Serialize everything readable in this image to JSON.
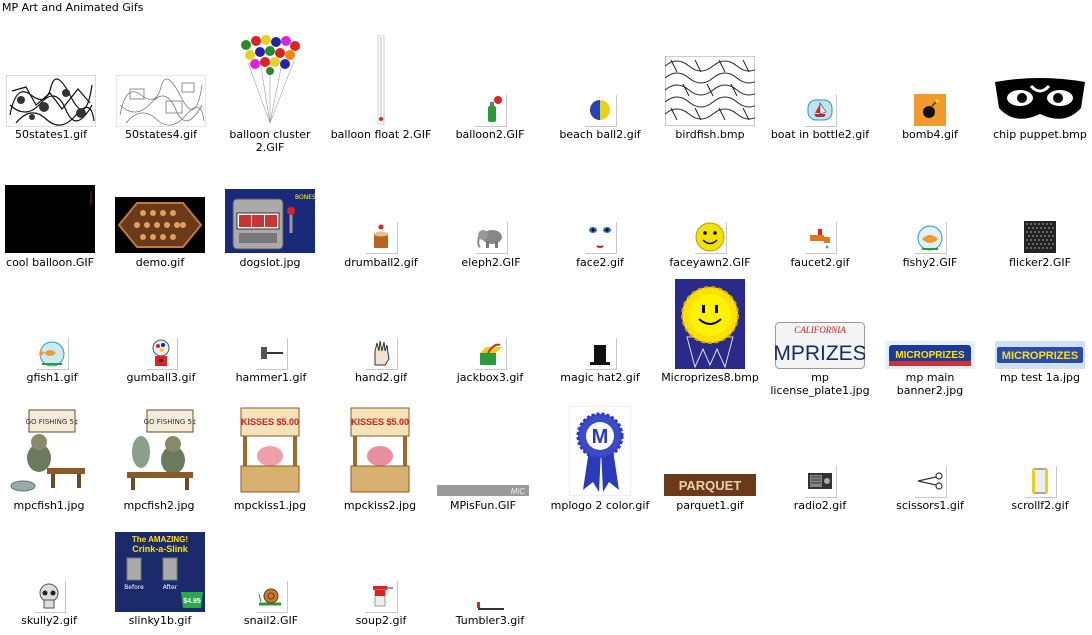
{
  "window": {
    "title": "MP Art and Animated Gifs"
  },
  "files": [
    {
      "name": "50states1.gif",
      "icon": "states-map-dark-thumbnail"
    },
    {
      "name": "50states4.gif",
      "icon": "states-map-light-thumbnail"
    },
    {
      "name": "balloon cluster 2.GIF",
      "icon": "balloon-cluster-thumbnail"
    },
    {
      "name": "balloon float 2.GIF",
      "icon": "balloon-float-thumbnail"
    },
    {
      "name": "balloon2.GIF",
      "icon": "balloon-tank-thumbnail"
    },
    {
      "name": "beach ball2.gif",
      "icon": "beach-ball-thumbnail"
    },
    {
      "name": "birdfish.bmp",
      "icon": "birdfish-pattern-thumbnail"
    },
    {
      "name": "boat in bottle2.gif",
      "icon": "boat-bottle-thumbnail"
    },
    {
      "name": "bomb4.gif",
      "icon": "bomb-thumbnail"
    },
    {
      "name": "chip puppet.bmp",
      "icon": "chip-puppet-thumbnail"
    },
    {
      "name": "cool balloon.GIF",
      "icon": "cool-balloon-thumbnail"
    },
    {
      "name": "demo.gif",
      "icon": "demo-hexagon-thumbnail"
    },
    {
      "name": "dogslot.jpg",
      "icon": "dog-slot-machine-thumbnail"
    },
    {
      "name": "drumball2.gif",
      "icon": "drum-thumbnail"
    },
    {
      "name": "eleph2.GIF",
      "icon": "elephant-thumbnail"
    },
    {
      "name": "face2.gif",
      "icon": "face-thumbnail"
    },
    {
      "name": "faceyawn2.GIF",
      "icon": "smiley-face-thumbnail"
    },
    {
      "name": "faucet2.gif",
      "icon": "faucet-thumbnail"
    },
    {
      "name": "fishy2.GIF",
      "icon": "fishbowl-thumbnail"
    },
    {
      "name": "flicker2.GIF",
      "icon": "flicker-grid-thumbnail"
    },
    {
      "name": "gfish1.gif",
      "icon": "goldfish-bowl-thumbnail"
    },
    {
      "name": "gumball3.gif",
      "icon": "gumball-machine-thumbnail"
    },
    {
      "name": "hammer1.gif",
      "icon": "hammer-thumbnail"
    },
    {
      "name": "hand2.gif",
      "icon": "hand-thumbnail"
    },
    {
      "name": "jackbox3.gif",
      "icon": "jack-in-box-thumbnail"
    },
    {
      "name": "magic hat2.gif",
      "icon": "magic-hat-thumbnail"
    },
    {
      "name": "Microprizes8.bmp",
      "icon": "microprizes-sun-badge-thumbnail"
    },
    {
      "name": "mp license_plate1.jpg",
      "icon": "license-plate-thumbnail",
      "plate_text": "MPRIZES",
      "plate_state": "CALIFORNIA"
    },
    {
      "name": "mp main banner2.jpg",
      "icon": "banner-thumbnail",
      "banner_text": "MICROPRIZES"
    },
    {
      "name": "mp test 1a.jpg",
      "icon": "banner-test-thumbnail",
      "banner_text": "MICROPRIZES"
    },
    {
      "name": "mpcfish1.jpg",
      "icon": "fishing-cat-thumbnail",
      "sign_text": "GO FISHING 5¢"
    },
    {
      "name": "mpcfish2.jpg",
      "icon": "fishing-cat-thumbnail",
      "sign_text": "GO FISHING 5¢"
    },
    {
      "name": "mpckiss1.jpg",
      "icon": "kissing-booth-thumbnail",
      "sign_text": "KISSES $5.00"
    },
    {
      "name": "mpckiss2.jpg",
      "icon": "kissing-booth-thumbnail",
      "sign_text": "KISSES $5.00"
    },
    {
      "name": "MPisFun.GIF",
      "icon": "mpisfun-bar-thumbnail",
      "bar_text": "MiC"
    },
    {
      "name": "mplogo 2 color.gif",
      "icon": "mp-logo-ribbon-thumbnail",
      "logo_letter": "M"
    },
    {
      "name": "parquet1.gif",
      "icon": "parquet-thumbnail",
      "sign_text": "PARQUET"
    },
    {
      "name": "radio2.gif",
      "icon": "radio-thumbnail"
    },
    {
      "name": "scissors1.gif",
      "icon": "scissors-thumbnail"
    },
    {
      "name": "scrollf2.gif",
      "icon": "scroll-thumbnail"
    },
    {
      "name": "skully2.gif",
      "icon": "skull-thumbnail"
    },
    {
      "name": "slinky1b.gif",
      "icon": "slinky-ad-thumbnail",
      "ad_title_1": "The AMAZING!",
      "ad_title_2": "Crink-a-Slink",
      "ad_before": "Before",
      "ad_after": "After",
      "ad_price": "$4.95"
    },
    {
      "name": "snail2.GIF",
      "icon": "snail-thumbnail"
    },
    {
      "name": "soup2.gif",
      "icon": "soup-can-thumbnail"
    },
    {
      "name": "Tumbler3.gif",
      "icon": "tumbler-thumbnail"
    }
  ]
}
